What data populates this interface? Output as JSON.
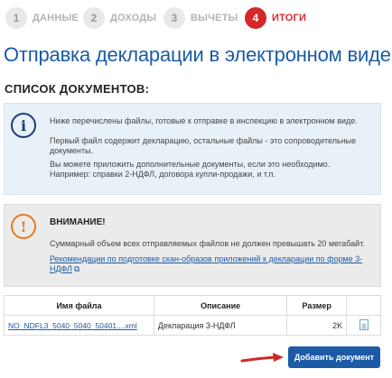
{
  "steps": [
    {
      "num": "1",
      "label": "ДАННЫЕ"
    },
    {
      "num": "2",
      "label": "ДОХОДЫ"
    },
    {
      "num": "3",
      "label": "ВЫЧЕТЫ"
    },
    {
      "num": "4",
      "label": "ИТОГИ"
    }
  ],
  "active_step": 4,
  "colors": {
    "brand": "#1a5ba5",
    "active_step": "#d3272c",
    "warning": "#e67b1f",
    "info_icon": "#1b3b7a"
  },
  "title": "Отправка декларации в электронном виде",
  "subtitle": "СПИСОК ДОКУМЕНТОВ:",
  "info": {
    "icon": "info-icon",
    "p1": "Ниже перечислены файлы, готовые к отправке в инспекцию в электронном виде.",
    "p2": "Первый файл содержит декларацию, остальные файлы - это сопроводительные документы.",
    "p3": "Вы можете приложить дополнительные документы, если это необходимо. Например: справки 2-НДФЛ, договора купли-продажи, и т.п."
  },
  "warning": {
    "icon": "warning-icon",
    "title": "ВНИМАНИЕ!",
    "text": "Суммарный объем всех отправляемых файлов не должен превышать 20 мегабайт.",
    "link": "Рекомендации по подготовке скан-образов приложений к декларации по форме 3-НДФЛ"
  },
  "table": {
    "headers": [
      "Имя файла",
      "Описание",
      "Размер",
      ""
    ],
    "rows": [
      {
        "filename": "NO_NDFL3_5040_5040_50401....xml",
        "description": "Декларация 3-НДФЛ",
        "size": "2K"
      }
    ]
  },
  "add_button": "Добавить документ"
}
